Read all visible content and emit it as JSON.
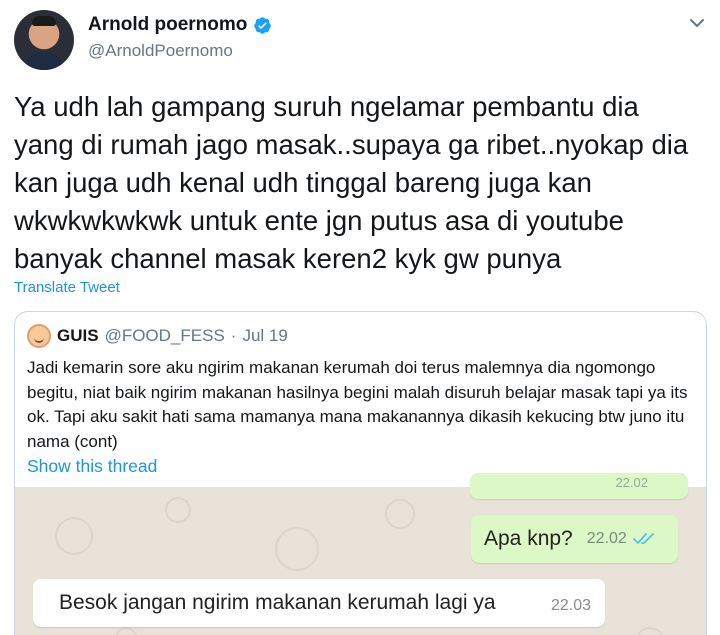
{
  "tweet": {
    "display_name": "Arnold poernomo",
    "handle": "@ArnoldPoernomo",
    "text": "Ya udh lah gampang suruh ngelamar pembantu dia\nyang di rumah jago masak..supaya ga ribet..nyokap dia\nkan juga udh kenal udh tinggal bareng juga kan\nwkwkwkwkwk untuk ente jgn putus asa di youtube\nbanyak channel masak keren2 kyk gw punya",
    "translate_label": "Translate Tweet",
    "accent_color": "#1b95e0"
  },
  "quote": {
    "name": "GUIS",
    "handle": "@FOOD_FESS",
    "separator": "·",
    "date": "Jul 19",
    "text": "Jadi kemarin sore aku ngirim makanan kerumah doi terus malemnya dia ngomongo begitu, niat baik ngirim makanan hasilnya begini malah disuruh belajar masak tapi ya its ok. Tapi aku sakit hati sama mamanya mana makanannya dikasih kekucing btw juno itu nama (cont)",
    "show_thread_label": "Show this thread"
  },
  "chat": {
    "partial_timestamp": "22.02",
    "messages": [
      {
        "direction": "out",
        "text": "Apa knp?",
        "time": "22.02",
        "read_icon": "double-check-icon"
      },
      {
        "direction": "in",
        "text": "Besok jangan ngirim makanan kerumah lagi ya",
        "time": "22.03"
      }
    ],
    "outgoing_color": "#dcf8c6",
    "incoming_color": "#ffffff"
  }
}
